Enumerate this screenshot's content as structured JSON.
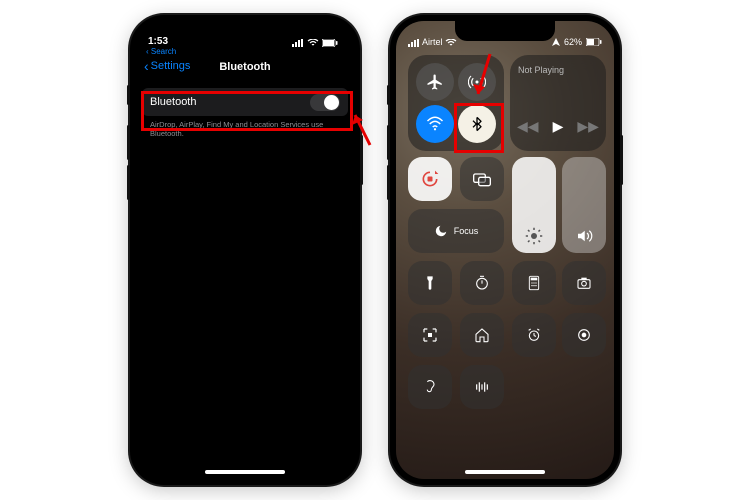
{
  "left": {
    "status": {
      "time": "1:53",
      "search_label": "Search"
    },
    "header": {
      "back_label": "Settings",
      "title": "Bluetooth"
    },
    "row": {
      "label": "Bluetooth",
      "toggle_on": false
    },
    "footer_note": "AirDrop, AirPlay, Find My and Location Services use Bluetooth."
  },
  "right": {
    "status": {
      "carrier": "Airtel",
      "battery": "62%"
    },
    "connectivity": {
      "airplane_icon": "airplane-icon",
      "cellular_icon": "antenna-icon",
      "wifi_icon": "wifi-icon",
      "bluetooth_icon": "bluetooth-icon"
    },
    "now_playing": {
      "title": "Not Playing"
    },
    "tiles": {
      "lock_rotation": "rotation-lock-icon",
      "mirror": "screen-mirror-icon",
      "focus_label": "Focus",
      "brightness": "sun-icon",
      "volume": "speaker-icon",
      "flashlight": "flashlight-icon",
      "timer": "timer-icon",
      "calculator": "calculator-icon",
      "camera": "camera-icon",
      "scan": "qr-scan-icon",
      "home": "home-icon",
      "alarm": "alarm-icon",
      "record": "record-icon",
      "hearing": "ear-icon",
      "haptics": "haptics-icon"
    }
  },
  "annotations": {
    "color": "#e60000"
  }
}
